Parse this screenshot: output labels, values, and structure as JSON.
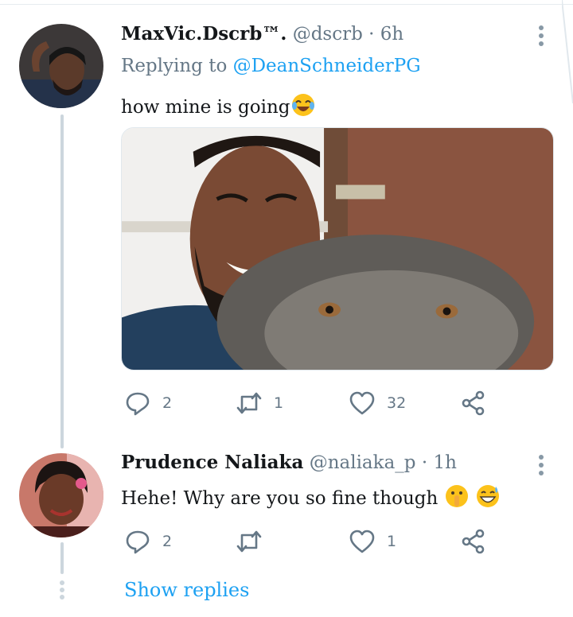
{
  "tweet": {
    "name": "MaxVic.Dscrb™.",
    "handle": "@dscrb",
    "separator": "·",
    "time": "6h",
    "replying_prefix": "Replying to",
    "replying_to": "@DeanSchneiderPG",
    "text": "how mine is going",
    "emoji": "face-with-tears-of-joy",
    "actions": {
      "replies": "2",
      "retweets": "1",
      "likes": "32"
    }
  },
  "reply": {
    "name": "Prudence Naliaka",
    "handle": "@naliaka_p",
    "separator": "·",
    "time": "1h",
    "text": "Hehe! Why are you so fine though",
    "emojis": [
      "shushing-face",
      "grinning-face-with-sweat"
    ],
    "actions": {
      "replies": "2",
      "retweets": "",
      "likes": "1"
    }
  },
  "show_replies_label": "Show replies",
  "colors": {
    "accent": "#1da1f2",
    "secondary_text": "#657786",
    "icon": "#657786",
    "thread_line": "#ccd6dd",
    "emoji_yellow": "#fcc21b"
  }
}
